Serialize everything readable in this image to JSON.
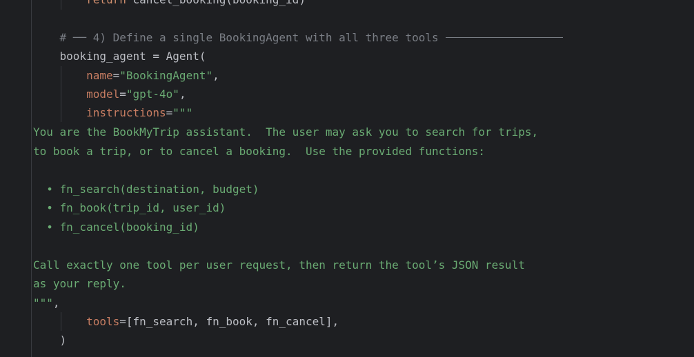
{
  "editor": {
    "colors": {
      "background": "#1e1f22",
      "text": "#bcbec4",
      "keyword": "#cf8e6d",
      "string": "#6aab73",
      "param": "#c77d62",
      "comment": "#7a7e85"
    },
    "lines": {
      "l0_kw": "return",
      "l0_rest": " cancel_booking(booking_id)",
      "l2_comment": "# ── 4) Define a single BookingAgent with all three tools",
      "l3": "booking_agent = Agent(",
      "l4_param": "name",
      "l4_eq": "=",
      "l4_str": "\"BookingAgent\"",
      "l4_comma": ",",
      "l5_param": "model",
      "l5_eq": "=",
      "l5_str": "\"gpt-4o\"",
      "l5_comma": ",",
      "l6_param": "instructions",
      "l6_eq": "=",
      "l6_str": "\"\"\"",
      "l7": "You are the BookMyTrip assistant.  The user may ask you to search for trips,",
      "l8": "to book a trip, or to cancel a booking.  Use the provided functions:",
      "l10": "  • fn_search(destination, budget)",
      "l11": "  • fn_book(trip_id, user_id)",
      "l12": "  • fn_cancel(booking_id)",
      "l14": "Call exactly one tool per user request, then return the tool’s JSON result",
      "l15": "as your reply.",
      "l16_str": "\"\"\"",
      "l16_comma": ",",
      "l17_param": "tools",
      "l17_rest": "=[fn_search, fn_book, fn_cancel],",
      "l18": ")"
    }
  }
}
